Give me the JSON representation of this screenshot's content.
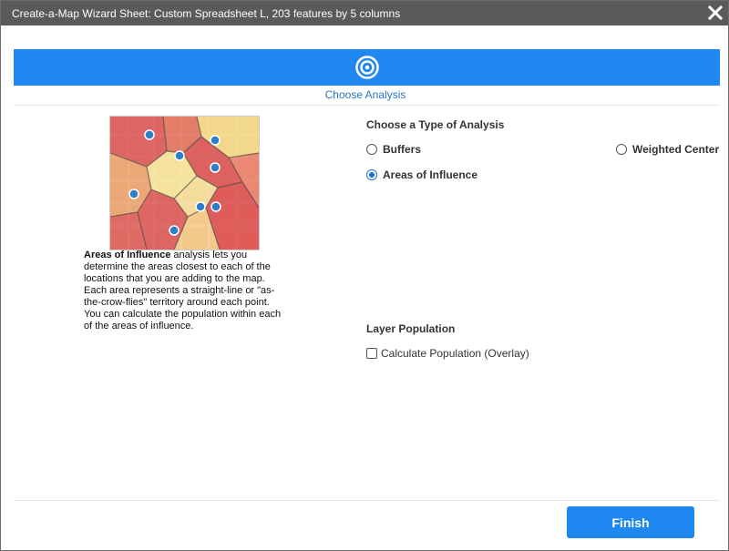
{
  "window": {
    "title": "Create-a-Map Wizard Sheet: Custom Spreadsheet L, 203 features by 5 columns",
    "close_icon": "close-icon"
  },
  "banner": {
    "icon": "target-icon",
    "color": "#1e87f0"
  },
  "step": {
    "label": "Choose Analysis"
  },
  "description": {
    "bold": "Areas of Influence",
    "text": " analysis lets you determine the areas closest to each of the locations that you are adding to the map. Each area represents a straight-line or \"as-the-crow-flies\" territory around each point. You can calculate the population within each of the areas of influence."
  },
  "analysis": {
    "heading": "Choose a Type of Analysis",
    "options": [
      {
        "label": "Buffers",
        "selected": false
      },
      {
        "label": "Weighted Center",
        "selected": false
      },
      {
        "label": "Areas of Influence",
        "selected": true
      }
    ]
  },
  "population": {
    "heading": "Layer Population",
    "checkbox_label": "Calculate Population (Overlay)",
    "checked": false
  },
  "footer": {
    "finish_label": "Finish"
  }
}
